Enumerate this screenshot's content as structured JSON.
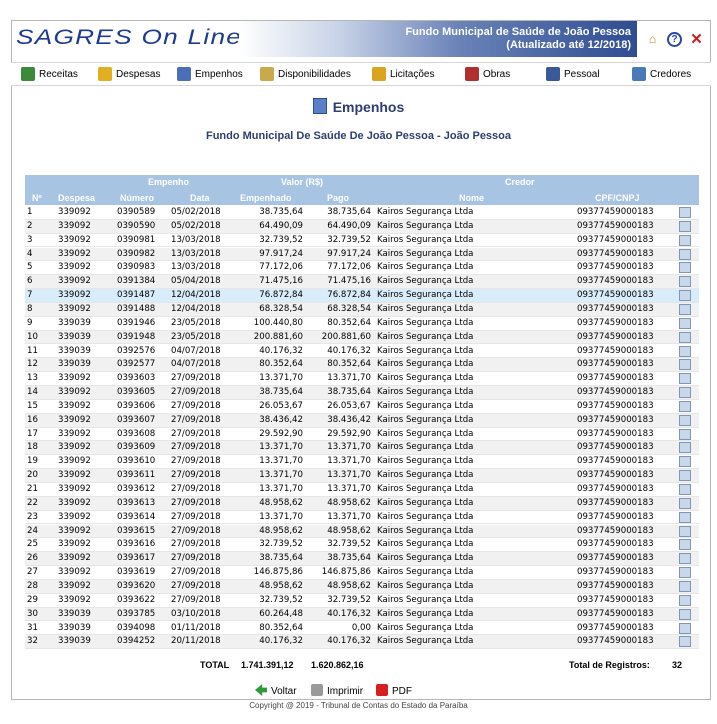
{
  "header": {
    "logo_left": "SAGRES",
    "logo_right": "On Line",
    "banner_title": "Fundo Municipal de Saúde de João Pessoa",
    "banner_subtitle": "(Atualizado até 12/2018)",
    "icons": [
      "home-icon",
      "help-icon",
      "close-icon"
    ]
  },
  "menu": [
    {
      "label": "Receitas",
      "icon": "spreadsheet-icon",
      "color": "#3a8a3a"
    },
    {
      "label": "Despesas",
      "icon": "document-icon",
      "color": "#e0b020"
    },
    {
      "label": "Empenhos",
      "icon": "pencil-doc-icon",
      "color": "#4a6fb8"
    },
    {
      "label": "Disponibilidades",
      "icon": "ledger-icon",
      "color": "#c9a94a"
    },
    {
      "label": "Licitações",
      "icon": "folder-icon",
      "color": "#d9a520"
    },
    {
      "label": "Obras",
      "icon": "construction-icon",
      "color": "#b03030"
    },
    {
      "label": "Pessoal",
      "icon": "people-icon",
      "color": "#3b5998"
    },
    {
      "label": "Credores",
      "icon": "creditor-icon",
      "color": "#4a7ab8"
    }
  ],
  "page": {
    "title": "Empenhos",
    "subtitle": "Fundo Municipal De Saúde De João Pessoa - João Pessoa"
  },
  "table": {
    "group_headers": {
      "empenho": "Empenho",
      "valor": "Valor (R$)",
      "credor": "Credor"
    },
    "columns": {
      "n": "Nº",
      "despesa": "Despesa",
      "numero": "Número",
      "data": "Data",
      "empenhado": "Empenhado",
      "pago": "Pago",
      "nome": "Nome",
      "cpf": "CPF/CNPJ"
    },
    "rows": [
      [
        "1",
        "339092",
        "0390589",
        "05/02/2018",
        "38.735,64",
        "38.735,64",
        "Kairos Segurança Ltda",
        "09377459000183"
      ],
      [
        "2",
        "339092",
        "0390590",
        "05/02/2018",
        "64.490,09",
        "64.490,09",
        "Kairos Segurança Ltda",
        "09377459000183"
      ],
      [
        "3",
        "339092",
        "0390981",
        "13/03/2018",
        "32.739,52",
        "32.739,52",
        "Kairos Segurança Ltda",
        "09377459000183"
      ],
      [
        "4",
        "339092",
        "0390982",
        "13/03/2018",
        "97.917,24",
        "97.917,24",
        "Kairos Segurança Ltda",
        "09377459000183"
      ],
      [
        "5",
        "339092",
        "0390983",
        "13/03/2018",
        "77.172,06",
        "77.172,06",
        "Kairos Segurança Ltda",
        "09377459000183"
      ],
      [
        "6",
        "339092",
        "0391384",
        "05/04/2018",
        "71.475,16",
        "71.475,16",
        "Kairos Segurança Ltda",
        "09377459000183"
      ],
      [
        "7",
        "339092",
        "0391487",
        "12/04/2018",
        "76.872,84",
        "76.872,84",
        "Kairos Segurança Ltda",
        "09377459000183"
      ],
      [
        "8",
        "339092",
        "0391488",
        "12/04/2018",
        "68.328,54",
        "68.328,54",
        "Kairos Segurança Ltda",
        "09377459000183"
      ],
      [
        "9",
        "339039",
        "0391946",
        "23/05/2018",
        "100.440,80",
        "80.352,64",
        "Kairos Segurança Ltda",
        "09377459000183"
      ],
      [
        "10",
        "339039",
        "0391948",
        "23/05/2018",
        "200.881,60",
        "200.881,60",
        "Kairos Segurança Ltda",
        "09377459000183"
      ],
      [
        "11",
        "339039",
        "0392576",
        "04/07/2018",
        "40.176,32",
        "40.176,32",
        "Kairos Segurança Ltda",
        "09377459000183"
      ],
      [
        "12",
        "339039",
        "0392577",
        "04/07/2018",
        "80.352,64",
        "80.352,64",
        "Kairos Segurança Ltda",
        "09377459000183"
      ],
      [
        "13",
        "339092",
        "0393603",
        "27/09/2018",
        "13.371,70",
        "13.371,70",
        "Kairos Segurança Ltda",
        "09377459000183"
      ],
      [
        "14",
        "339092",
        "0393605",
        "27/09/2018",
        "38.735,64",
        "38.735,64",
        "Kairos Segurança Ltda",
        "09377459000183"
      ],
      [
        "15",
        "339092",
        "0393606",
        "27/09/2018",
        "26.053,67",
        "26.053,67",
        "Kairos Segurança Ltda",
        "09377459000183"
      ],
      [
        "16",
        "339092",
        "0393607",
        "27/09/2018",
        "38.436,42",
        "38.436,42",
        "Kairos Segurança Ltda",
        "09377459000183"
      ],
      [
        "17",
        "339092",
        "0393608",
        "27/09/2018",
        "29.592,90",
        "29.592,90",
        "Kairos Segurança Ltda",
        "09377459000183"
      ],
      [
        "18",
        "339092",
        "0393609",
        "27/09/2018",
        "13.371,70",
        "13.371,70",
        "Kairos Segurança Ltda",
        "09377459000183"
      ],
      [
        "19",
        "339092",
        "0393610",
        "27/09/2018",
        "13.371,70",
        "13.371,70",
        "Kairos Segurança Ltda",
        "09377459000183"
      ],
      [
        "20",
        "339092",
        "0393611",
        "27/09/2018",
        "13.371,70",
        "13.371,70",
        "Kairos Segurança Ltda",
        "09377459000183"
      ],
      [
        "21",
        "339092",
        "0393612",
        "27/09/2018",
        "13.371,70",
        "13.371,70",
        "Kairos Segurança Ltda",
        "09377459000183"
      ],
      [
        "22",
        "339092",
        "0393613",
        "27/09/2018",
        "48.958,62",
        "48.958,62",
        "Kairos Segurança Ltda",
        "09377459000183"
      ],
      [
        "23",
        "339092",
        "0393614",
        "27/09/2018",
        "13.371,70",
        "13.371,70",
        "Kairos Segurança Ltda",
        "09377459000183"
      ],
      [
        "24",
        "339092",
        "0393615",
        "27/09/2018",
        "48.958,62",
        "48.958,62",
        "Kairos Segurança Ltda",
        "09377459000183"
      ],
      [
        "25",
        "339092",
        "0393616",
        "27/09/2018",
        "32.739,52",
        "32.739,52",
        "Kairos Segurança Ltda",
        "09377459000183"
      ],
      [
        "26",
        "339092",
        "0393617",
        "27/09/2018",
        "38.735,64",
        "38.735,64",
        "Kairos Segurança Ltda",
        "09377459000183"
      ],
      [
        "27",
        "339092",
        "0393619",
        "27/09/2018",
        "146.875,86",
        "146.875,86",
        "Kairos Segurança Ltda",
        "09377459000183"
      ],
      [
        "28",
        "339092",
        "0393620",
        "27/09/2018",
        "48.958,62",
        "48.958,62",
        "Kairos Segurança Ltda",
        "09377459000183"
      ],
      [
        "29",
        "339092",
        "0393622",
        "27/09/2018",
        "32.739,52",
        "32.739,52",
        "Kairos Segurança Ltda",
        "09377459000183"
      ],
      [
        "30",
        "339039",
        "0393785",
        "03/10/2018",
        "60.264,48",
        "40.176,32",
        "Kairos Segurança Ltda",
        "09377459000183"
      ],
      [
        "31",
        "339039",
        "0394098",
        "01/11/2018",
        "80.352,64",
        "0,00",
        "Kairos Segurança Ltda",
        "09377459000183"
      ],
      [
        "32",
        "339039",
        "0394252",
        "20/11/2018",
        "40.176,32",
        "40.176,32",
        "Kairos Segurança Ltda",
        "09377459000183"
      ]
    ],
    "highlighted_row": 7
  },
  "totals": {
    "label": "TOTAL",
    "empenhado": "1.741.391,12",
    "pago": "1.620.862,16",
    "registros_label": "Total de Registros:",
    "registros_value": "32"
  },
  "footer": {
    "voltar": "Voltar",
    "imprimir": "Imprimir",
    "pdf": "PDF",
    "copyright": "Copyright @ 2019 - Tribunal de Contas do Estado da Paraíba"
  }
}
